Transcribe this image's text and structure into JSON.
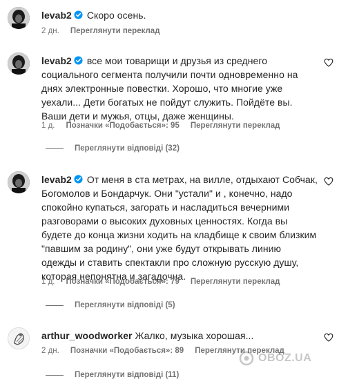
{
  "comments": [
    {
      "username": "levab2",
      "verified": true,
      "text": "Скоро осень.",
      "time": "2 дн.",
      "likes": "",
      "translate": "Переглянути переклад",
      "replies": ""
    },
    {
      "username": "levab2",
      "verified": true,
      "text": "все мои товарищи и друзья из среднего социального сегмента получили почти одновременно на днях электронные повестки. Хорошо, что многие уже уехали... Дети богатых не пойдут служить. Пойдёте вы. Ваши дети и мужья, отцы, даже женщины.",
      "time": "1 д.",
      "likes": "Позначки «Подобається»: 95",
      "translate": "Переглянути переклад",
      "replies": "Переглянути відповіді (32)"
    },
    {
      "username": "levab2",
      "verified": true,
      "text": "От меня в ста метрах, на вилле, отдыхают Собчак, Богомолов и Бондарчук. Они \"устали\" и , конечно, надо спокойно купаться, загорать и насладиться вечерними разговорами о высоких духовных ценностях. Когда вы будете до конца жизни ходить на кладбище к своим близким \"павшим за родину\", они уже будут открывать линию одежды и ставить спектакли про сложную русскую душу, которая непонятна и загадочна.",
      "time": "1 д.",
      "likes": "Позначки «Подобається»: 79",
      "translate": "Переглянути переклад",
      "replies": "Переглянути відповіді (5)"
    },
    {
      "username": "arthur_woodworker",
      "verified": false,
      "text": "Жалко, музыка хорошая...",
      "time": "2 дн.",
      "likes": "Позначки «Подобається»: 89",
      "translate": "Переглянути переклад",
      "replies": "Переглянути відповіді (11)"
    }
  ],
  "watermark": "OBOZ.UA",
  "colors": {
    "text": "#262626",
    "secondary": "#737373",
    "verified": "#0095f6"
  }
}
